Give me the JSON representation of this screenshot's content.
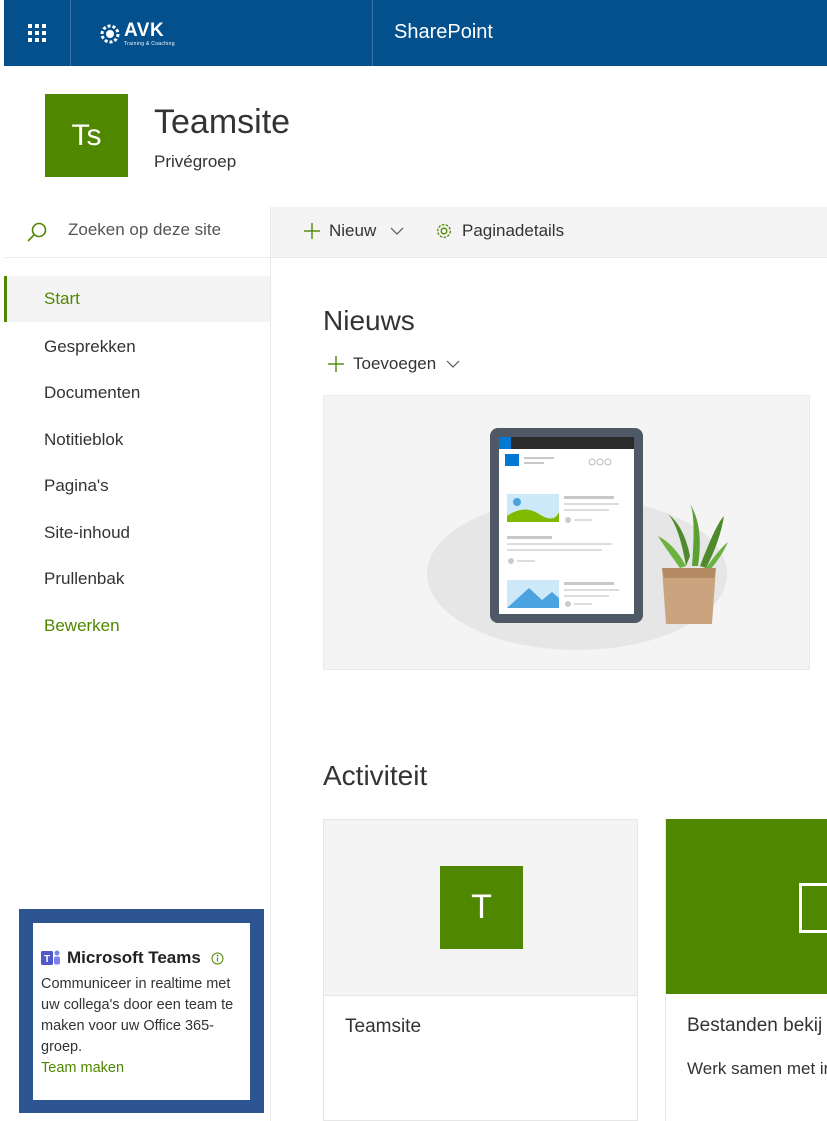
{
  "suitebar": {
    "logo": {
      "name": "AVK",
      "tagline": "Training & Coaching"
    },
    "app_title": "SharePoint",
    "color": "#03508d"
  },
  "site": {
    "logo_initials": "Ts",
    "title": "Teamsite",
    "subtitle": "Privégroep",
    "accent_color": "#508700"
  },
  "search": {
    "placeholder": "Zoeken op deze site"
  },
  "nav": {
    "items": [
      {
        "label": "Start",
        "active": true
      },
      {
        "label": "Gesprekken"
      },
      {
        "label": "Documenten"
      },
      {
        "label": "Notitieblok"
      },
      {
        "label": "Pagina's"
      },
      {
        "label": "Site-inhoud"
      },
      {
        "label": "Prullenbak"
      }
    ],
    "edit_label": "Bewerken"
  },
  "commandbar": {
    "new_label": "Nieuw",
    "page_details_label": "Paginadetails"
  },
  "news": {
    "title": "Nieuws",
    "add_label": "Toevoegen"
  },
  "activity": {
    "title": "Activiteit",
    "cards": [
      {
        "tile_initial": "T",
        "title": "Teamsite"
      },
      {
        "title": "Bestanden bekij",
        "description": "Werk samen met inhoud."
      }
    ]
  },
  "teams_card": {
    "title": "Microsoft Teams",
    "text": "Communiceer in realtime met uw collega's door een team te maken voor uw Office 365-groep.",
    "link": "Team maken",
    "frame_color": "#2d5591"
  },
  "icons": [
    "waffle-icon",
    "search-icon",
    "plus-icon",
    "chevron-down-icon",
    "gear-icon",
    "teams-icon",
    "info-icon"
  ]
}
